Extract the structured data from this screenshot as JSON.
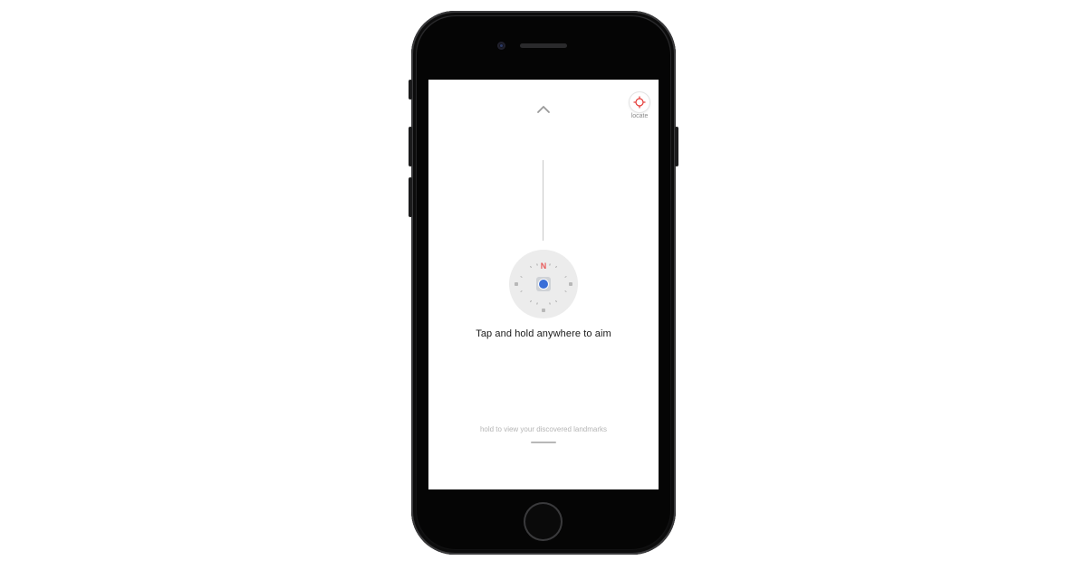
{
  "screen": {
    "top_chevron_icon": "chevron-up-icon",
    "locate": {
      "icon": "crosshair-icon",
      "label": "locate",
      "icon_color": "#e53935"
    },
    "compass": {
      "north_label": "N",
      "north_color": "#e85a5a",
      "position_dot_color": "#3a6fd8"
    },
    "instruction_text": "Tap and hold anywhere to aim",
    "landmarks_hint": "hold to view your discovered landmarks"
  }
}
